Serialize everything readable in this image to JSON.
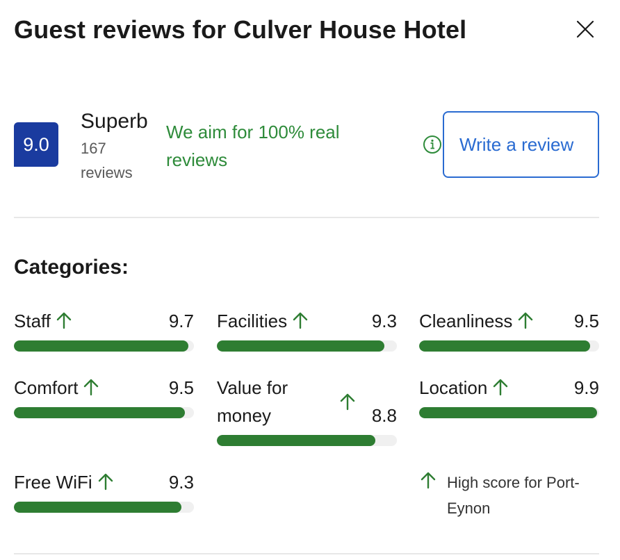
{
  "header": {
    "title": "Guest reviews for Culver House Hotel",
    "close_icon": "close-icon"
  },
  "summary": {
    "score": "9.0",
    "rating_word": "Superb",
    "review_count": "167 reviews",
    "aim_text": "We aim for 100% real reviews",
    "info_icon": "info-icon",
    "write_review_label": "Write a review"
  },
  "categories": {
    "heading": "Categories:",
    "items": [
      {
        "name": "Staff",
        "score": "9.7",
        "fill": 0.97,
        "icon": "arrow-up-icon"
      },
      {
        "name": "Facilities",
        "score": "9.3",
        "fill": 0.93,
        "icon": "arrow-up-icon"
      },
      {
        "name": "Cleanliness",
        "score": "9.5",
        "fill": 0.95,
        "icon": "arrow-up-icon"
      },
      {
        "name": "Comfort",
        "score": "9.5",
        "fill": 0.95,
        "icon": "arrow-up-icon"
      },
      {
        "name": "Value for money",
        "score": "8.8",
        "fill": 0.88,
        "icon": "arrow-up-icon"
      },
      {
        "name": "Location",
        "score": "9.9",
        "fill": 0.99,
        "icon": "arrow-up-icon"
      },
      {
        "name": "Free WiFi",
        "score": "9.3",
        "fill": 0.93,
        "icon": "arrow-up-icon"
      }
    ],
    "note": "High score for Port-Eynon"
  },
  "colors": {
    "badge": "#1a3b9f",
    "accent_green": "#2e7d32",
    "link_blue": "#2a6bd1"
  }
}
